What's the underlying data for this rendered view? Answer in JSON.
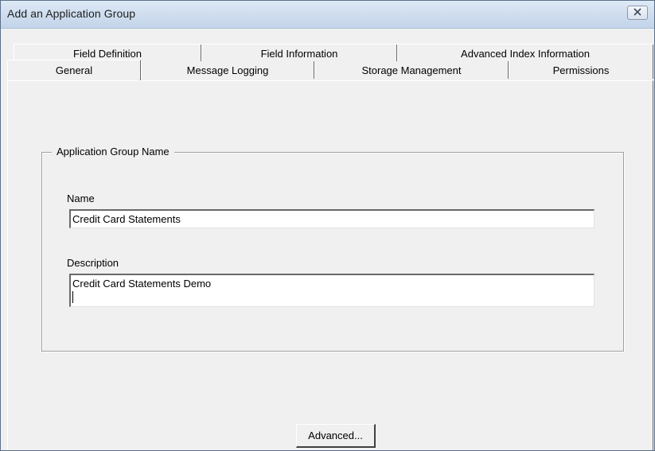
{
  "window": {
    "title": "Add an Application Group",
    "close_icon": "close-icon"
  },
  "tabs": {
    "back_row": [
      {
        "label": "Field Definition"
      },
      {
        "label": "Field Information"
      },
      {
        "label": "Advanced Index Information"
      }
    ],
    "front_row": [
      {
        "label": "General",
        "selected": true
      },
      {
        "label": "Message Logging"
      },
      {
        "label": "Storage Management"
      },
      {
        "label": "Permissions"
      }
    ]
  },
  "group": {
    "legend": "Application Group Name",
    "name_label": "Name",
    "name_value": "Credit Card Statements",
    "description_label": "Description",
    "description_value": "Credit Card Statements Demo"
  },
  "buttons": {
    "advanced": "Advanced..."
  }
}
